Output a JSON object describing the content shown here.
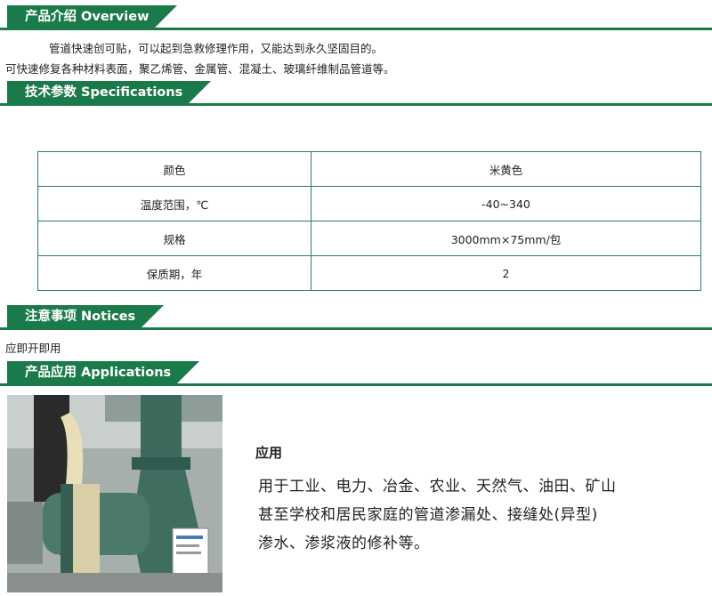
{
  "overview": {
    "title": "产品介绍  Overview",
    "line1": "管道快速创可贴，可以起到急救修理作用，又能达到永久坚固目的。",
    "line2": "可快速修复各种材料表面，聚乙烯管、金属管、混凝土、玻璃纤维制品管道等。"
  },
  "specifications": {
    "title": "技术参数  Specifications",
    "rows": [
      {
        "label": "颜色",
        "value": "米黄色"
      },
      {
        "label": "温度范围，℃",
        "value": "-40~340"
      },
      {
        "label": "规格",
        "value": "3000mm×75mm/包"
      },
      {
        "label": "保质期，年",
        "value": "2"
      }
    ]
  },
  "notices": {
    "title": "注意事项  Notices",
    "text": "应即开即用"
  },
  "applications": {
    "title": "产品应用  Applications",
    "heading": "应用",
    "lines": [
      "用于工业、电力、冶金、农业、天然气、油田、矿山",
      "甚至学校和居民家庭的管道渗漏处、接缝处(异型)",
      "渗水、渗浆液的修补等。"
    ]
  },
  "colors": {
    "accent": "#1b7a4a",
    "table_border": "#2e7a6a"
  }
}
